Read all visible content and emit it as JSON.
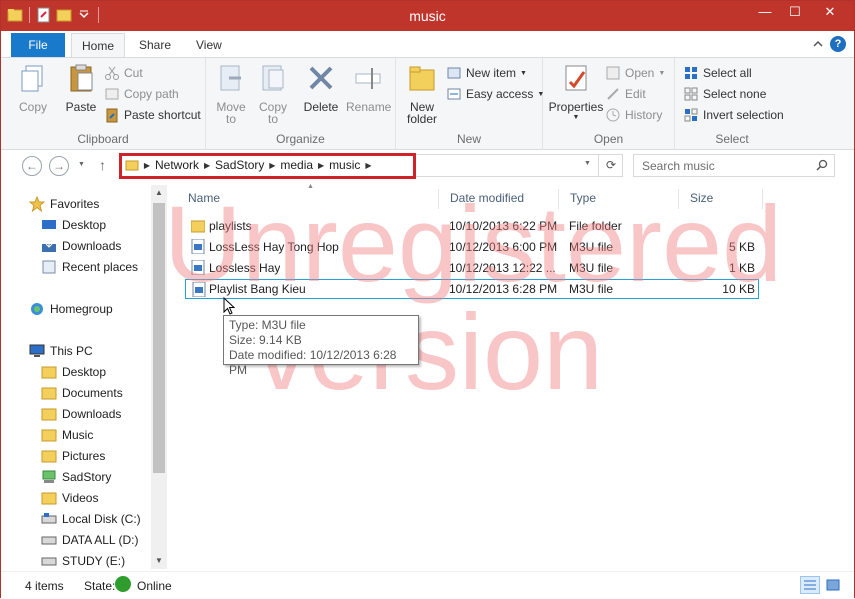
{
  "window": {
    "title": "music",
    "controls": {
      "minimize": "—",
      "maximize": "☐",
      "close": "✕"
    }
  },
  "ribbon_tabs": [
    {
      "label": "File"
    },
    {
      "label": "Home"
    },
    {
      "label": "Share"
    },
    {
      "label": "View"
    }
  ],
  "ribbon": {
    "clipboard": {
      "label": "Clipboard",
      "copy": "Copy",
      "paste": "Paste",
      "cut": "Cut",
      "copy_path": "Copy path",
      "paste_shortcut": "Paste shortcut"
    },
    "organize": {
      "label": "Organize",
      "move_to": "Move",
      "move_to_2": "to",
      "copy_to": "Copy",
      "copy_to_2": "to",
      "delete": "Delete",
      "rename": "Rename"
    },
    "new": {
      "label": "New",
      "new_folder": "New",
      "new_folder_2": "folder",
      "new_item": "New item",
      "easy_access": "Easy access"
    },
    "open": {
      "label": "Open",
      "properties": "Properties",
      "open": "Open",
      "edit": "Edit",
      "history": "History"
    },
    "select": {
      "label": "Select",
      "select_all": "Select all",
      "select_none": "Select none",
      "invert_selection": "Invert selection"
    }
  },
  "address": {
    "crumbs": [
      "Network",
      "SadStory",
      "media",
      "music"
    ],
    "search_placeholder": "Search music"
  },
  "navigation": {
    "favorites": {
      "label": "Favorites",
      "items": [
        "Desktop",
        "Downloads",
        "Recent places"
      ]
    },
    "homegroup": "Homegroup",
    "this_pc": {
      "label": "This PC",
      "items": [
        "Desktop",
        "Documents",
        "Downloads",
        "Music",
        "Pictures",
        "SadStory",
        "Videos",
        "Local Disk (C:)",
        "DATA ALL (D:)",
        "STUDY (E:)"
      ]
    }
  },
  "columns": [
    "Name",
    "Date modified",
    "Type",
    "Size"
  ],
  "files": [
    {
      "name": "playlists",
      "date": "10/10/2013 6:22 PM",
      "type": "File folder",
      "size": "",
      "kind": "folder"
    },
    {
      "name": "LossLess Hay Tong Hop",
      "date": "10/12/2013 6:00 PM",
      "type": "M3U file",
      "size": "5 KB",
      "kind": "m3u"
    },
    {
      "name": "Lossless Hay",
      "date": "10/12/2013 12:22 ...",
      "type": "M3U file",
      "size": "1 KB",
      "kind": "m3u"
    },
    {
      "name": "Playlist Bang Kieu",
      "date": "10/12/2013 6:28 PM",
      "type": "M3U file",
      "size": "10 KB",
      "kind": "m3u",
      "selected": true
    }
  ],
  "tooltip": {
    "type": "Type: M3U file",
    "size": "Size: 9.14 KB",
    "modified": "Date modified: 10/12/2013 6:28 PM"
  },
  "watermark": {
    "line1": "Unregistered",
    "line2": "version"
  },
  "status": {
    "count": "4 items",
    "state_label": "State:",
    "state_value": "Online"
  },
  "colors": {
    "titlebar": "#c0352b",
    "file_tab": "#1979ca",
    "highlight_box": "#d0222a",
    "selection_border": "#26a0da",
    "watermark": "#f08080"
  }
}
